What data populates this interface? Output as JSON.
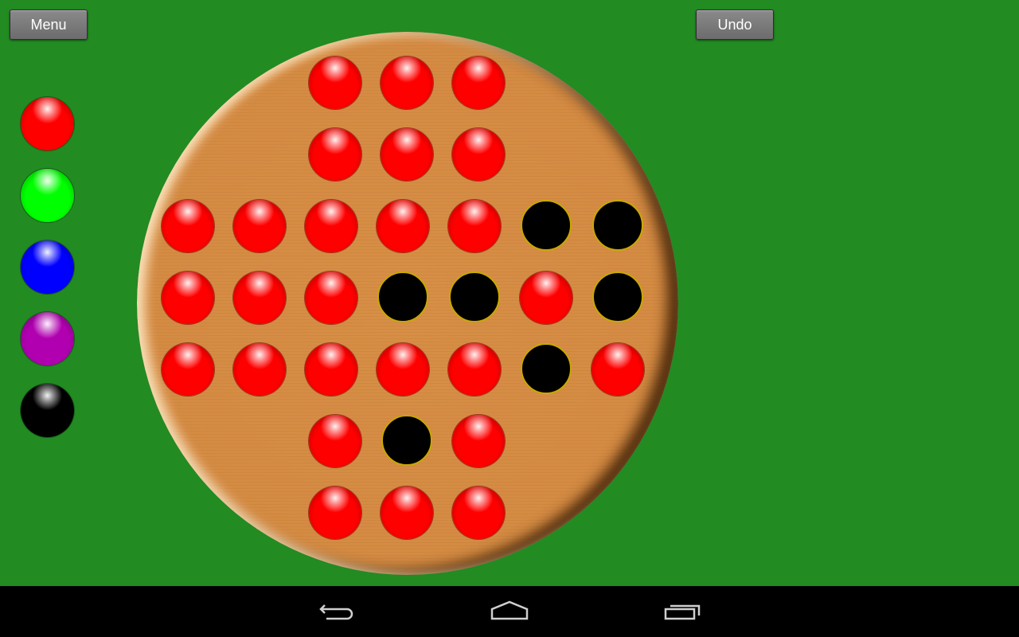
{
  "toolbar": {
    "menu_label": "Menu",
    "undo_label": "Undo"
  },
  "colors": {
    "background": "#228b22",
    "board": "#d48a42",
    "peg_red": "#ff0000",
    "hole_empty": "#000000",
    "hole_rim": "#c9a800"
  },
  "palette": [
    {
      "name": "red",
      "color": "#ff0000"
    },
    {
      "name": "green",
      "color": "#00ff00"
    },
    {
      "name": "blue",
      "color": "#0000ff"
    },
    {
      "name": "purple",
      "color": "#b000b0"
    },
    {
      "name": "black",
      "color": "#000000"
    }
  ],
  "board": {
    "type": "english-peg-solitaire",
    "peg_color": "red",
    "rows": [
      [
        null,
        null,
        "peg",
        "peg",
        "peg",
        null,
        null
      ],
      [
        null,
        null,
        "peg",
        "peg",
        "peg",
        null,
        null
      ],
      [
        "peg",
        "peg",
        "peg",
        "peg",
        "peg",
        "empty",
        "empty"
      ],
      [
        "peg",
        "peg",
        "peg",
        "empty",
        "empty",
        "peg",
        "empty"
      ],
      [
        "peg",
        "peg",
        "peg",
        "peg",
        "peg",
        "empty",
        "peg"
      ],
      [
        null,
        null,
        "peg",
        "empty",
        "peg",
        null,
        null
      ],
      [
        null,
        null,
        "peg",
        "peg",
        "peg",
        null,
        null
      ]
    ]
  },
  "navbar": {
    "back_icon": "back-arrow-icon",
    "home_icon": "home-icon",
    "recents_icon": "recent-apps-icon"
  }
}
